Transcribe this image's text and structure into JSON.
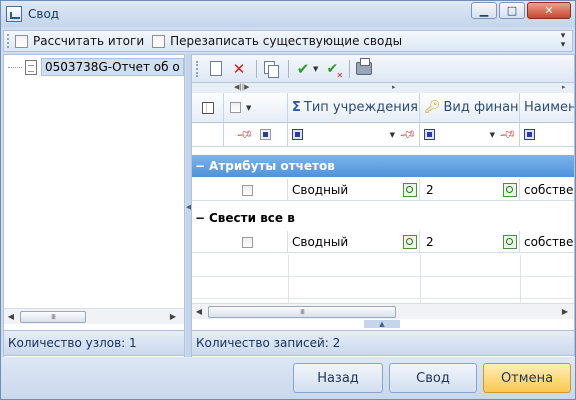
{
  "window": {
    "title": "Свод"
  },
  "options": {
    "calc_totals": "Рассчитать итоги",
    "overwrite": "Перезаписать существующие своды"
  },
  "tree": {
    "node_label": "0503738G-Отчет об о"
  },
  "left_status": "Количество узлов: 1",
  "grid": {
    "columns": {
      "type": "Тип учреждения",
      "finance": "Вид финанс",
      "name": "Наимен"
    },
    "groups": [
      {
        "label": "Атрибуты отчетов",
        "toggle": "−",
        "row": {
          "type": "Сводный",
          "finance": "2",
          "name": "собстве"
        }
      },
      {
        "label": "Свести все в",
        "toggle": "−",
        "row": {
          "type": "Сводный",
          "finance": "2",
          "name": "собстве"
        }
      }
    ]
  },
  "right_status": "Количество записей: 2",
  "buttons": {
    "back": "Назад",
    "consolidate": "Свод",
    "cancel": "Отмена"
  },
  "colors": {
    "group_header": "#4f93db",
    "primary_button": "#f9c851"
  }
}
